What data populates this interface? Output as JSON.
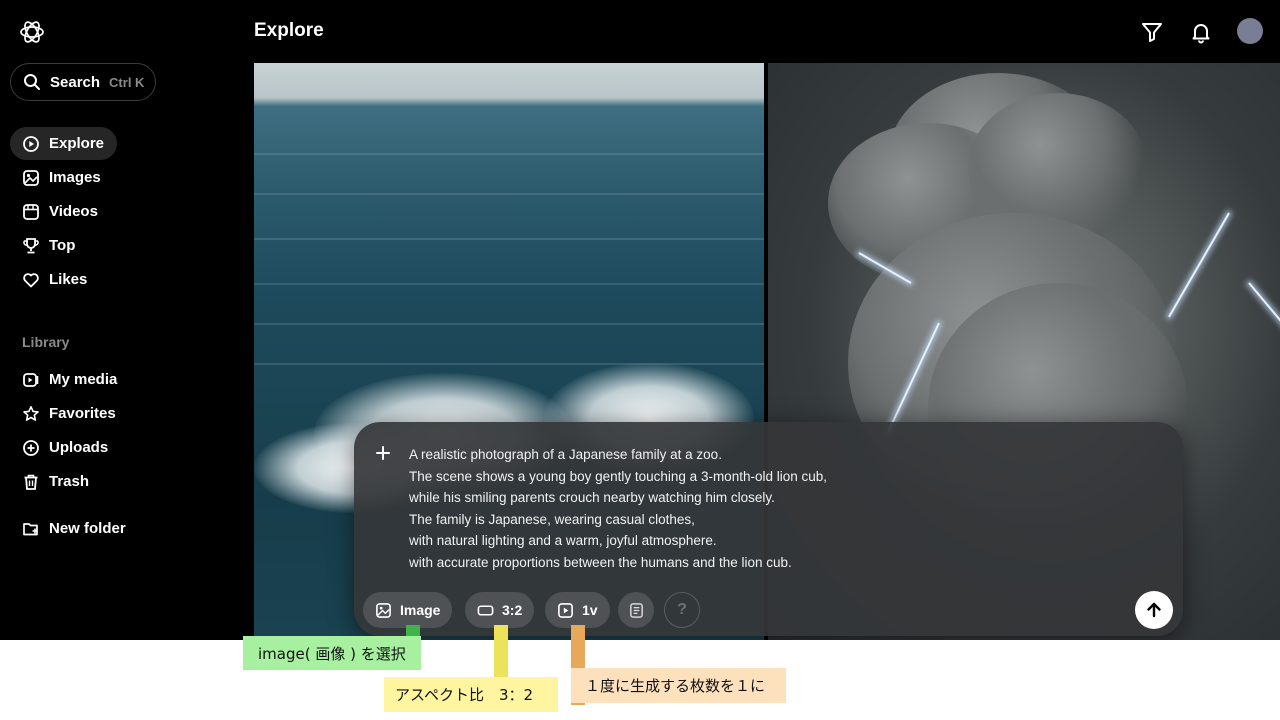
{
  "sidebar": {
    "search": {
      "label": "Search",
      "shortcut": "Ctrl K"
    },
    "nav": [
      {
        "label": "Explore",
        "icon": "explore-icon",
        "active": true
      },
      {
        "label": "Images",
        "icon": "image-icon"
      },
      {
        "label": "Videos",
        "icon": "video-icon"
      },
      {
        "label": "Top",
        "icon": "trophy-icon"
      },
      {
        "label": "Likes",
        "icon": "heart-icon"
      }
    ],
    "library_title": "Library",
    "library": [
      {
        "label": "My media",
        "icon": "media-icon"
      },
      {
        "label": "Favorites",
        "icon": "star-icon"
      },
      {
        "label": "Uploads",
        "icon": "upload-icon"
      },
      {
        "label": "Trash",
        "icon": "trash-icon"
      }
    ],
    "new_folder": {
      "label": "New folder",
      "icon": "folder-plus-icon"
    }
  },
  "header": {
    "title": "Explore",
    "icons": [
      "filter-icon",
      "bell-icon",
      "avatar"
    ]
  },
  "gallery": [
    {
      "subject": "ocean-waves"
    },
    {
      "subject": "storm-cloud-mammoth"
    }
  ],
  "composer": {
    "prompt_lines": [
      "A realistic photograph of a Japanese family at a zoo.",
      "The scene shows a young boy gently touching a 3-month-old lion cub,",
      "while his smiling parents crouch nearby watching him closely.",
      "The family is Japanese, wearing casual clothes,",
      "with natural lighting and a warm, joyful atmosphere.",
      "with accurate proportions between the humans and the lion cub."
    ],
    "chips": {
      "mode": "Image",
      "aspect": "3:2",
      "count": "1v",
      "help": "?"
    }
  },
  "annotations": {
    "image_select": "image( 画像 ) を選択",
    "aspect_ratio": "アスペクト比　3：2",
    "count_per_generation": "１度に生成する枚数を１に"
  },
  "colors": {
    "background": "#000000",
    "active_nav": "#262626",
    "anno_green": "#a6f0a0",
    "anno_yellow": "#fff5a0",
    "anno_orange": "#fde0bc",
    "line_green": "#3fb24a",
    "line_yellow": "#ede35a",
    "line_orange": "#e8a85a"
  }
}
